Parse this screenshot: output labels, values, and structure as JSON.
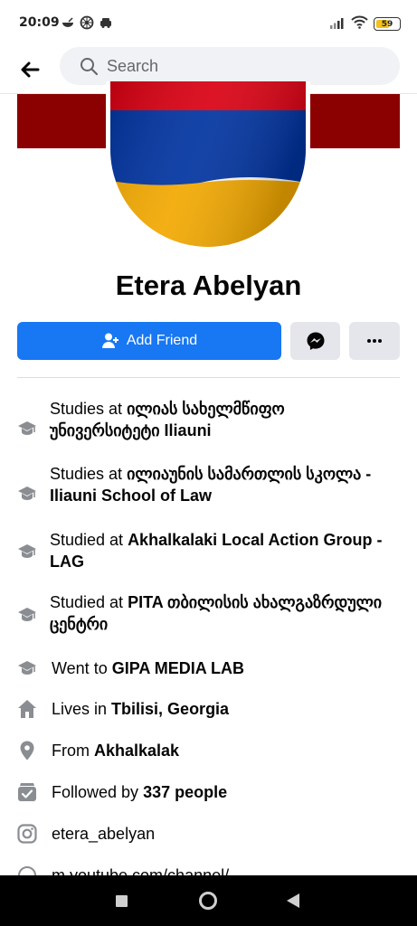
{
  "status_bar": {
    "time": "20:09",
    "battery_level": "59",
    "battery_fraction": 0.59
  },
  "search": {
    "placeholder": "Search"
  },
  "profile": {
    "name": "Etera Abelyan",
    "flag_colors": [
      "#d90012",
      "#0033a0",
      "#f2a800"
    ],
    "cover_color": "#8b0000"
  },
  "actions": {
    "add_friend_label": "Add Friend",
    "primary_color": "#1877f2"
  },
  "details": [
    {
      "icon": "graduation-cap-icon",
      "prefix": "Studies at ",
      "bold": "ილიას სახელმწიფო უნივერსიტეტი Iliauni"
    },
    {
      "icon": "graduation-cap-icon",
      "prefix": "Studies at ",
      "bold": "ილიაუნის სამართლის სკოლა - Iliauni School of Law"
    },
    {
      "icon": "graduation-cap-icon",
      "prefix": "Studied at ",
      "bold": "Akhalkalaki Local Action Group - LAG"
    },
    {
      "icon": "graduation-cap-icon",
      "prefix": "Studied at ",
      "bold": "PITA თბილისის ახალგაზრდული ცენტრი"
    },
    {
      "icon": "graduation-cap-icon",
      "prefix": "Went to ",
      "bold": "GIPA MEDIA LAB"
    },
    {
      "icon": "home-icon",
      "prefix": "Lives in ",
      "bold": "Tbilisi, Georgia"
    },
    {
      "icon": "location-pin-icon",
      "prefix": "From ",
      "bold": "Akhalkalak"
    },
    {
      "icon": "followers-icon",
      "prefix": "Followed by ",
      "bold": "337 people"
    },
    {
      "icon": "instagram-icon",
      "prefix": "etera_abelyan",
      "bold": ""
    },
    {
      "icon": "link-icon",
      "prefix": "m.youtube.com/channel/",
      "bold": ""
    }
  ]
}
